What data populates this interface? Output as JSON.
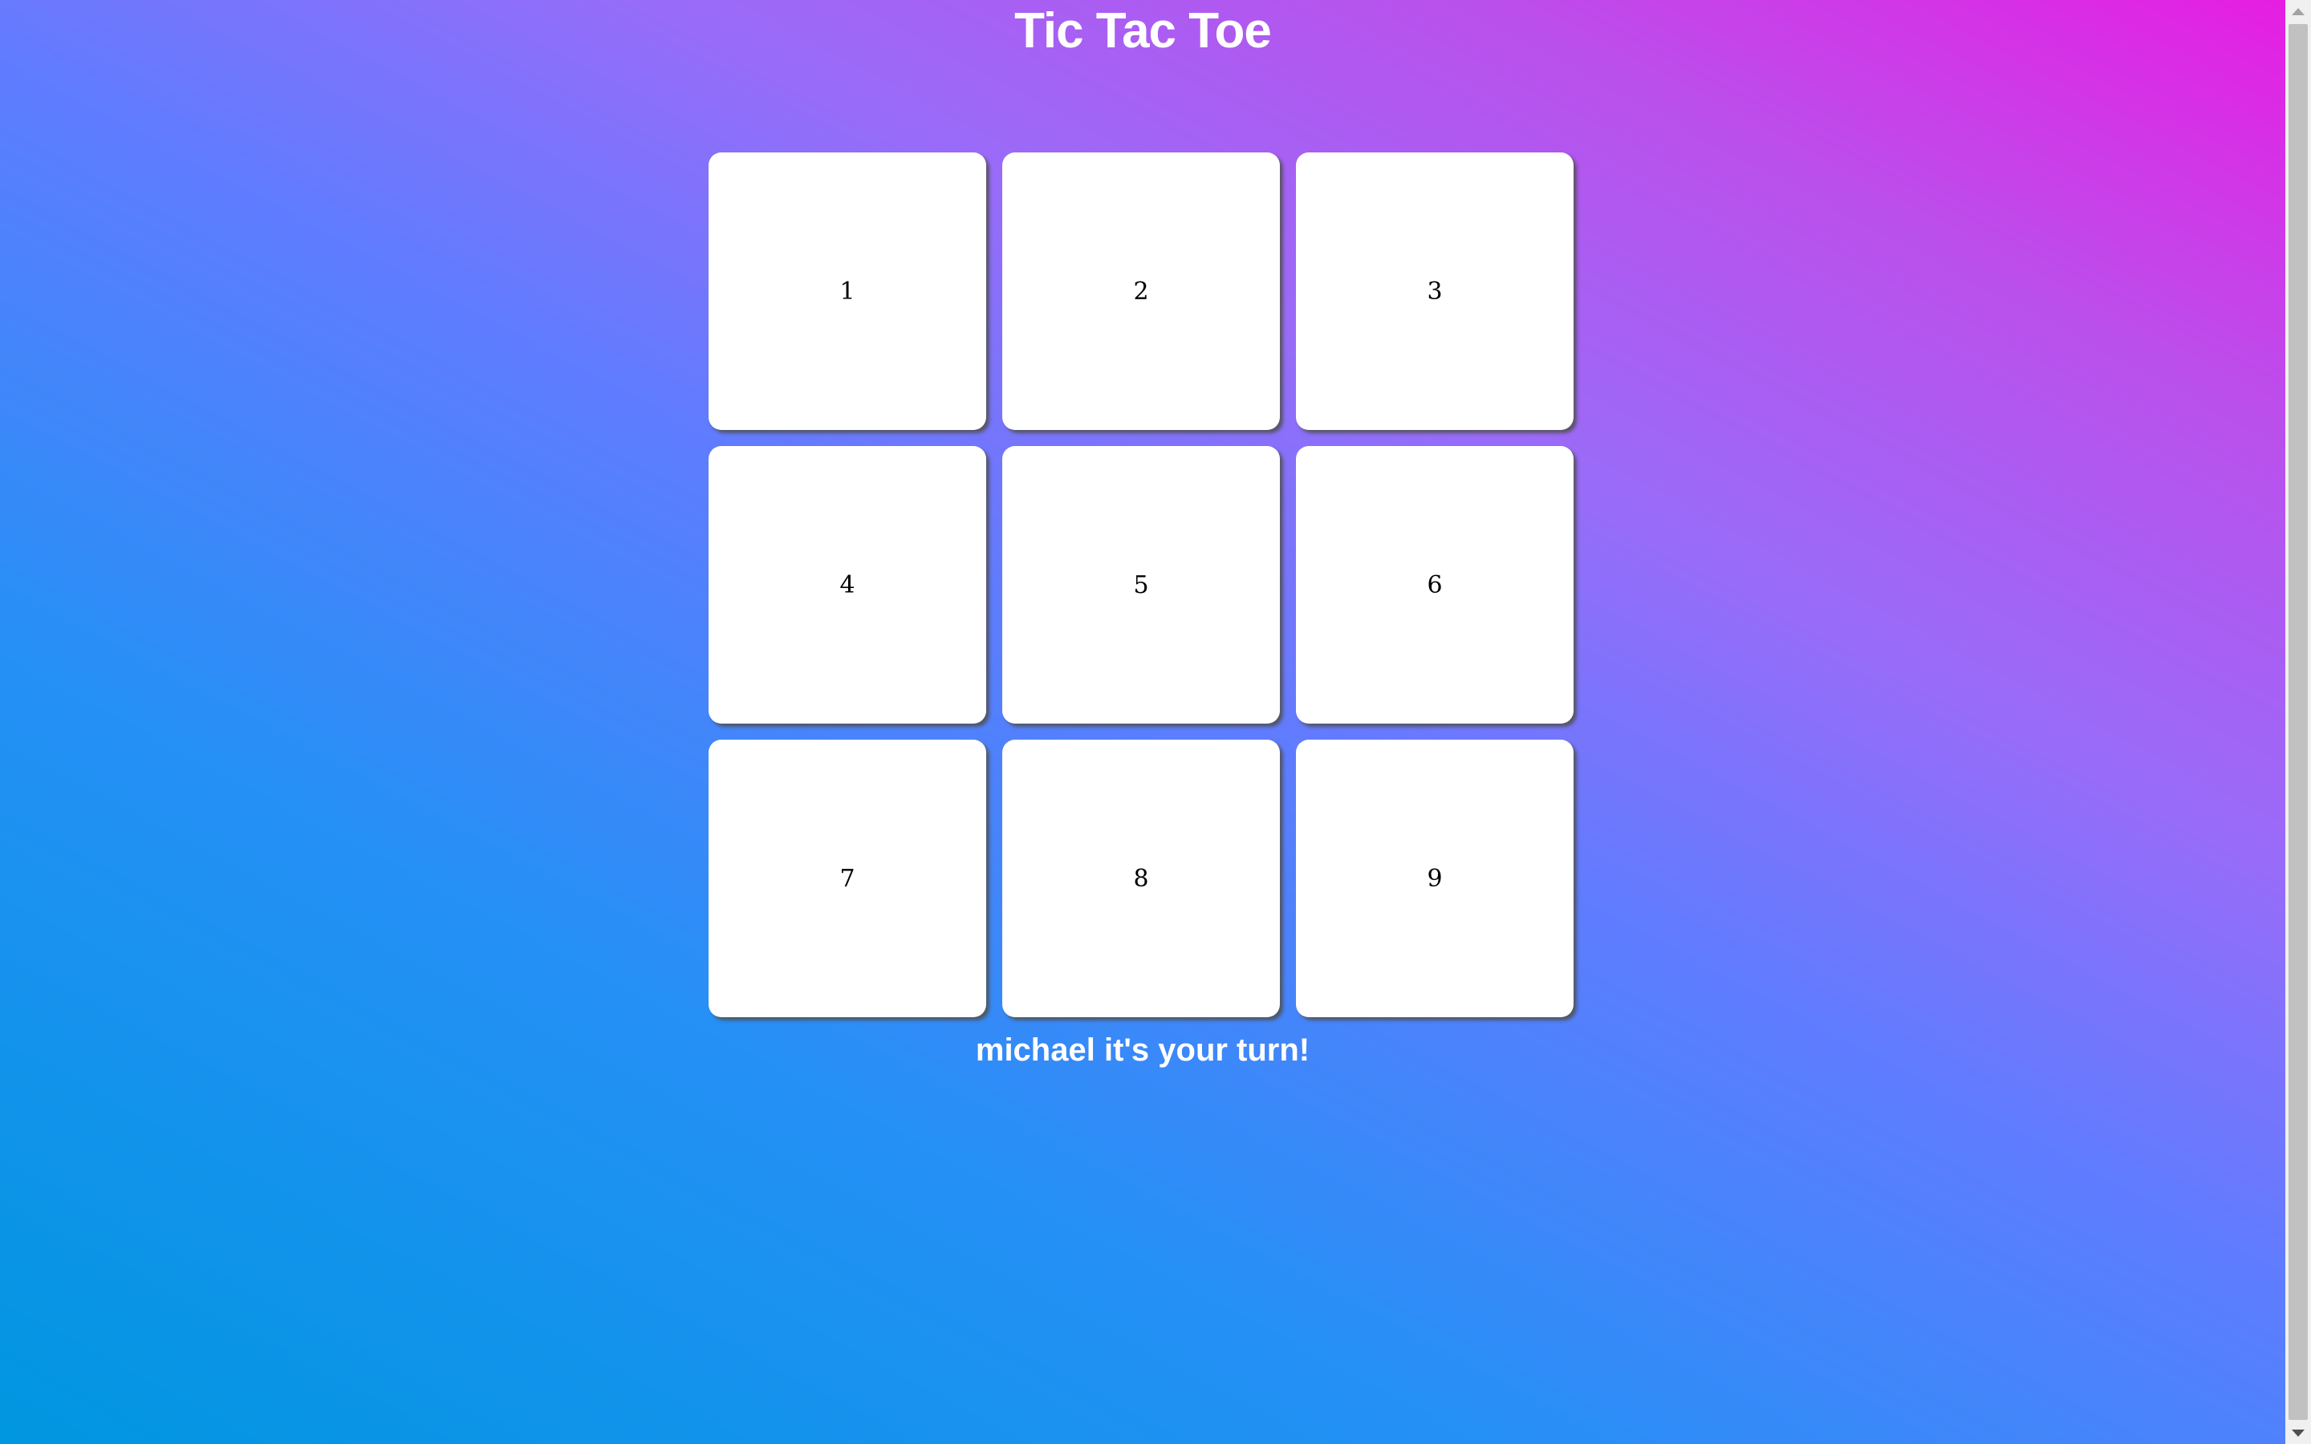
{
  "app": {
    "title": "Tic Tac Toe"
  },
  "board": {
    "cells": [
      {
        "label": "1"
      },
      {
        "label": "2"
      },
      {
        "label": "3"
      },
      {
        "label": "4"
      },
      {
        "label": "5"
      },
      {
        "label": "6"
      },
      {
        "label": "7"
      },
      {
        "label": "8"
      },
      {
        "label": "9"
      }
    ]
  },
  "status": {
    "text": "michael it's your turn!"
  },
  "colors": {
    "gradient_start": "#0096e0",
    "gradient_end": "#e61ee2",
    "cell_background": "#ffffff",
    "text_light": "#ffffff"
  },
  "icons": {
    "scroll_up": "triangle-up-icon",
    "scroll_down": "triangle-down-icon"
  }
}
